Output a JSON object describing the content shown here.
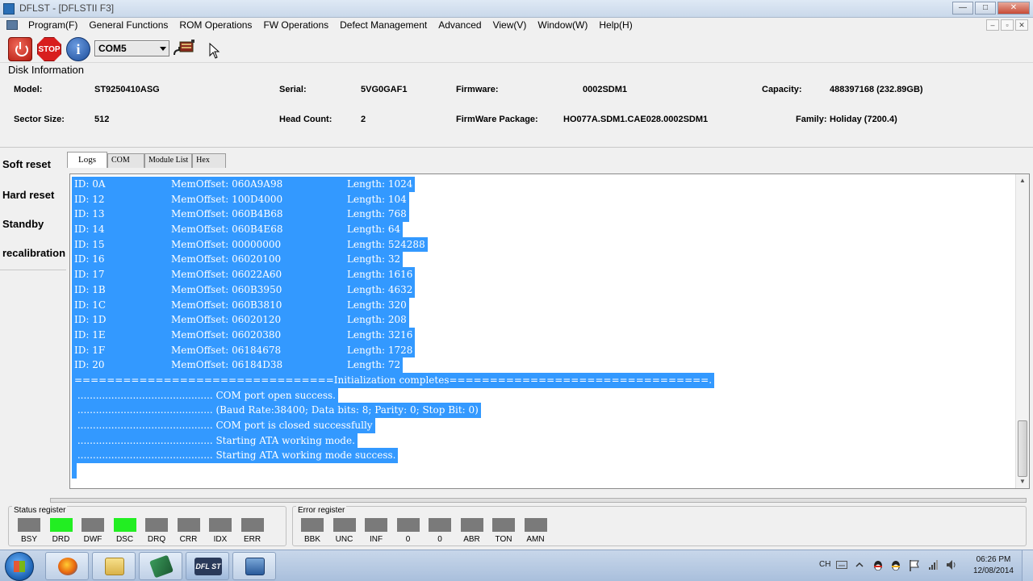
{
  "window": {
    "title": "DFLST - [DFLSTII F3]"
  },
  "menu": [
    "Program(F)",
    "General Functions",
    "ROM Operations",
    "FW Operations",
    "Defect Management",
    "Advanced",
    "View(V)",
    "Window(W)",
    "Help(H)"
  ],
  "toolbar": {
    "stop_label": "STOP",
    "info_label": "i",
    "port": "COM5"
  },
  "disk_info": {
    "title": "Disk Information",
    "model_label": "Model:",
    "model": "ST9250410ASG",
    "serial_label": "Serial:",
    "serial": "5VG0GAF1",
    "firmware_label": "Firmware:",
    "firmware": "0002SDM1",
    "capacity_label": "Capacity:",
    "capacity": "488397168 (232.89GB)",
    "sector_label": "Sector Size:",
    "sector": "512",
    "head_label": "Head Count:",
    "head": "2",
    "package_label": "FirmWare Package:",
    "package": "HO077A.SDM1.CAE028.0002SDM1",
    "family_label": "Family:",
    "family": "Holiday (7200.4)"
  },
  "side_buttons": [
    "Soft reset",
    "Hard reset",
    "Standby",
    "recalibration"
  ],
  "tabs": [
    "Logs",
    "COM",
    "Module List",
    "Hex"
  ],
  "log": {
    "modules": [
      {
        "id": "ID: 0A",
        "mem": "MemOffset: 060A9A98",
        "len": "Length: 1024"
      },
      {
        "id": "ID: 12",
        "mem": "MemOffset: 100D4000",
        "len": "Length: 104"
      },
      {
        "id": "ID: 13",
        "mem": "MemOffset: 060B4B68",
        "len": "Length: 768"
      },
      {
        "id": "ID: 14",
        "mem": "MemOffset: 060B4E68",
        "len": "Length: 64"
      },
      {
        "id": "ID: 15",
        "mem": "MemOffset: 00000000",
        "len": "Length: 524288"
      },
      {
        "id": "ID: 16",
        "mem": "MemOffset: 06020100",
        "len": "Length: 32"
      },
      {
        "id": "ID: 17",
        "mem": "MemOffset: 06022A60",
        "len": "Length: 1616"
      },
      {
        "id": "ID: 1B",
        "mem": "MemOffset: 060B3950",
        "len": "Length: 4632"
      },
      {
        "id": "ID: 1C",
        "mem": "MemOffset: 060B3810",
        "len": "Length: 320"
      },
      {
        "id": "ID: 1D",
        "mem": "MemOffset: 06020120",
        "len": "Length: 208"
      },
      {
        "id": "ID: 1E",
        "mem": "MemOffset: 06020380",
        "len": "Length: 3216"
      },
      {
        "id": "ID: 1F",
        "mem": "MemOffset: 06184678",
        "len": "Length: 1728"
      },
      {
        "id": "ID: 20",
        "mem": "MemOffset: 06184D38",
        "len": "Length: 72"
      }
    ],
    "init_line": "================================Initialization completes================================.",
    "status_lines": [
      " ............................................ COM port open success.",
      " ............................................ (Baud Rate:38400; Data bits: 8; Parity: 0; Stop Bit: 0)",
      " ............................................ COM port is closed successfully",
      " ............................................ Starting ATA working mode.",
      " ............................................ Starting ATA working mode success."
    ]
  },
  "status_register": {
    "title": "Status register",
    "bits": [
      {
        "label": "BSY",
        "on": false
      },
      {
        "label": "DRD",
        "on": true
      },
      {
        "label": "DWF",
        "on": false
      },
      {
        "label": "DSC",
        "on": true
      },
      {
        "label": "DRQ",
        "on": false
      },
      {
        "label": "CRR",
        "on": false
      },
      {
        "label": "IDX",
        "on": false
      },
      {
        "label": "ERR",
        "on": false
      }
    ]
  },
  "error_register": {
    "title": "Error register",
    "bits": [
      {
        "label": "BBK",
        "on": false
      },
      {
        "label": "UNC",
        "on": false
      },
      {
        "label": "INF",
        "on": false
      },
      {
        "label": "0",
        "on": false
      },
      {
        "label": "0",
        "on": false
      },
      {
        "label": "ABR",
        "on": false
      },
      {
        "label": "TON",
        "on": false
      },
      {
        "label": "AMN",
        "on": false
      }
    ]
  },
  "taskbar": {
    "apps": [
      "firefox",
      "file-explorer",
      "tool-app",
      "dflst-app",
      "computer-app"
    ],
    "dflst_label": "DFL ST",
    "tray_lang": "CH",
    "time": "06:26 PM",
    "date": "12/08/2014"
  },
  "colors": {
    "selection": "#3399ff",
    "register_on": "#22ee22",
    "register_off": "#7a7a7a"
  }
}
